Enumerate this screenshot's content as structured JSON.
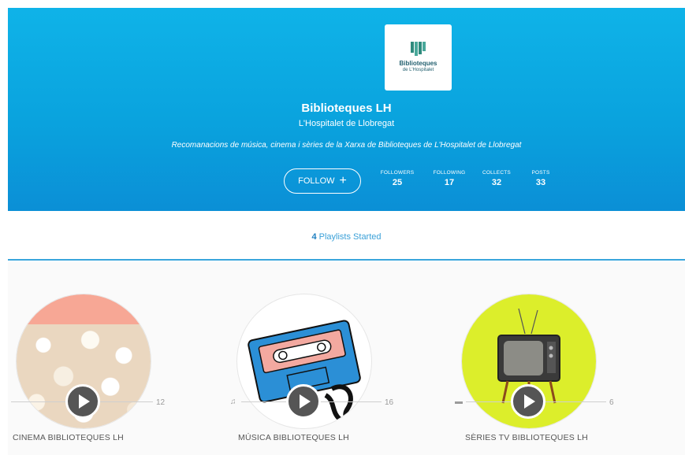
{
  "profile": {
    "logo_text_1": "Biblioteques",
    "logo_text_2": "de L'Hospitalet",
    "name": "Biblioteques LH",
    "location": "L'Hospitalet de Llobregat",
    "description": "Recomanacions de música, cinema i sèries de la Xarxa de Biblioteques de L'Hospitalet de Llobregat",
    "follow_label": "FOLLOW",
    "follow_symbol": "+",
    "stats": [
      {
        "label": "FOLLOWERS",
        "value": "25"
      },
      {
        "label": "FOLLOWING",
        "value": "17"
      },
      {
        "label": "COLLECTS",
        "value": "32"
      },
      {
        "label": "POSTS",
        "value": "33"
      }
    ]
  },
  "tabs": {
    "playlists_count": "4",
    "playlists_label": " Playlists Started"
  },
  "playlists": [
    {
      "title": "CINEMA BIBLIOTEQUES LH",
      "count": "12",
      "type_icon": "film-icon",
      "cover": "popcorn"
    },
    {
      "title": "MÚSICA BIBLIOTEQUES LH",
      "count": "16",
      "type_icon": "music-note-icon",
      "type_glyph": "♫",
      "cover": "cassette"
    },
    {
      "title": "SÈRIES TV BIBLIOTEQUES LH",
      "count": "6",
      "type_icon": "video-icon",
      "type_glyph": "▬",
      "cover": "tv"
    }
  ],
  "colors": {
    "banner": "#0aa3de",
    "accent": "#3aa6dc",
    "tv_background": "#dcee2b",
    "cassette_blue": "#2b8fd6",
    "popcorn_top": "#f7a795"
  }
}
